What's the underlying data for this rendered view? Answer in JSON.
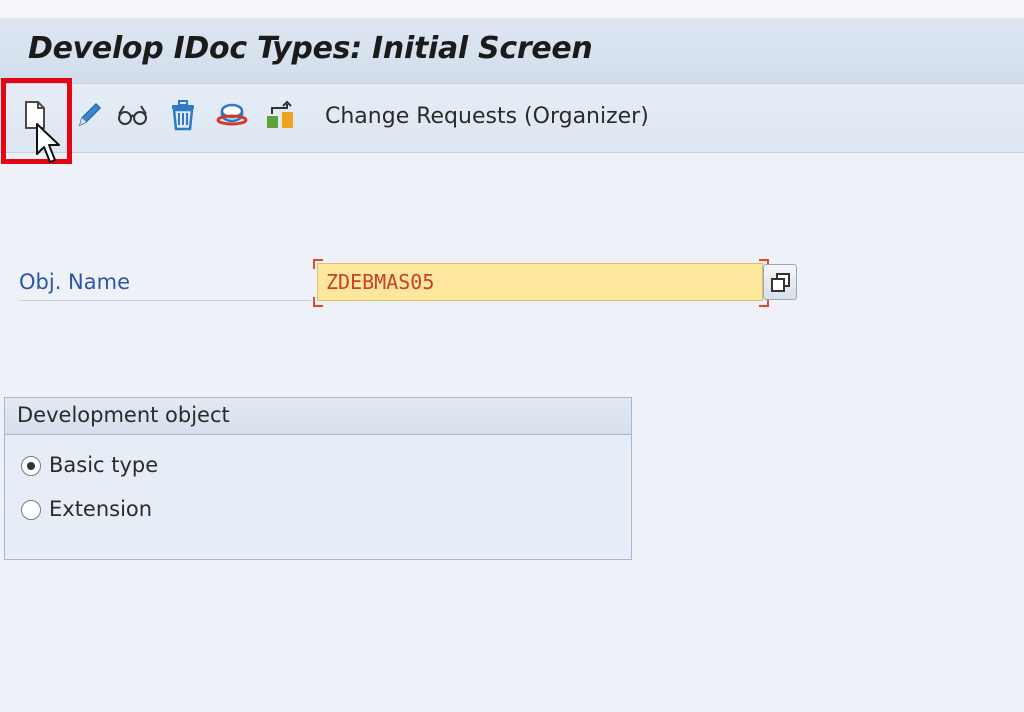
{
  "window": {
    "title": "Develop IDoc Types: Initial Screen"
  },
  "toolbar": {
    "icons": [
      "create-icon",
      "change-pencil-icon",
      "display-glasses-icon",
      "delete-trash-icon",
      "check-icon",
      "where-used-icon"
    ],
    "change_requests_label": "Change Requests (Organizer)",
    "highlighted_button": "create-icon"
  },
  "form": {
    "obj_name_label": "Obj. Name",
    "obj_name_value": "ZDEBMAS05"
  },
  "development_object": {
    "title": "Development object",
    "options": [
      {
        "label": "Basic type",
        "selected": true
      },
      {
        "label": "Extension",
        "selected": false
      }
    ]
  },
  "colors": {
    "highlight_border": "#e30613",
    "field_background": "#fce79c",
    "field_text": "#c7412a",
    "label_blue": "#2c56a3",
    "icon_blue": "#2f7ac8"
  }
}
